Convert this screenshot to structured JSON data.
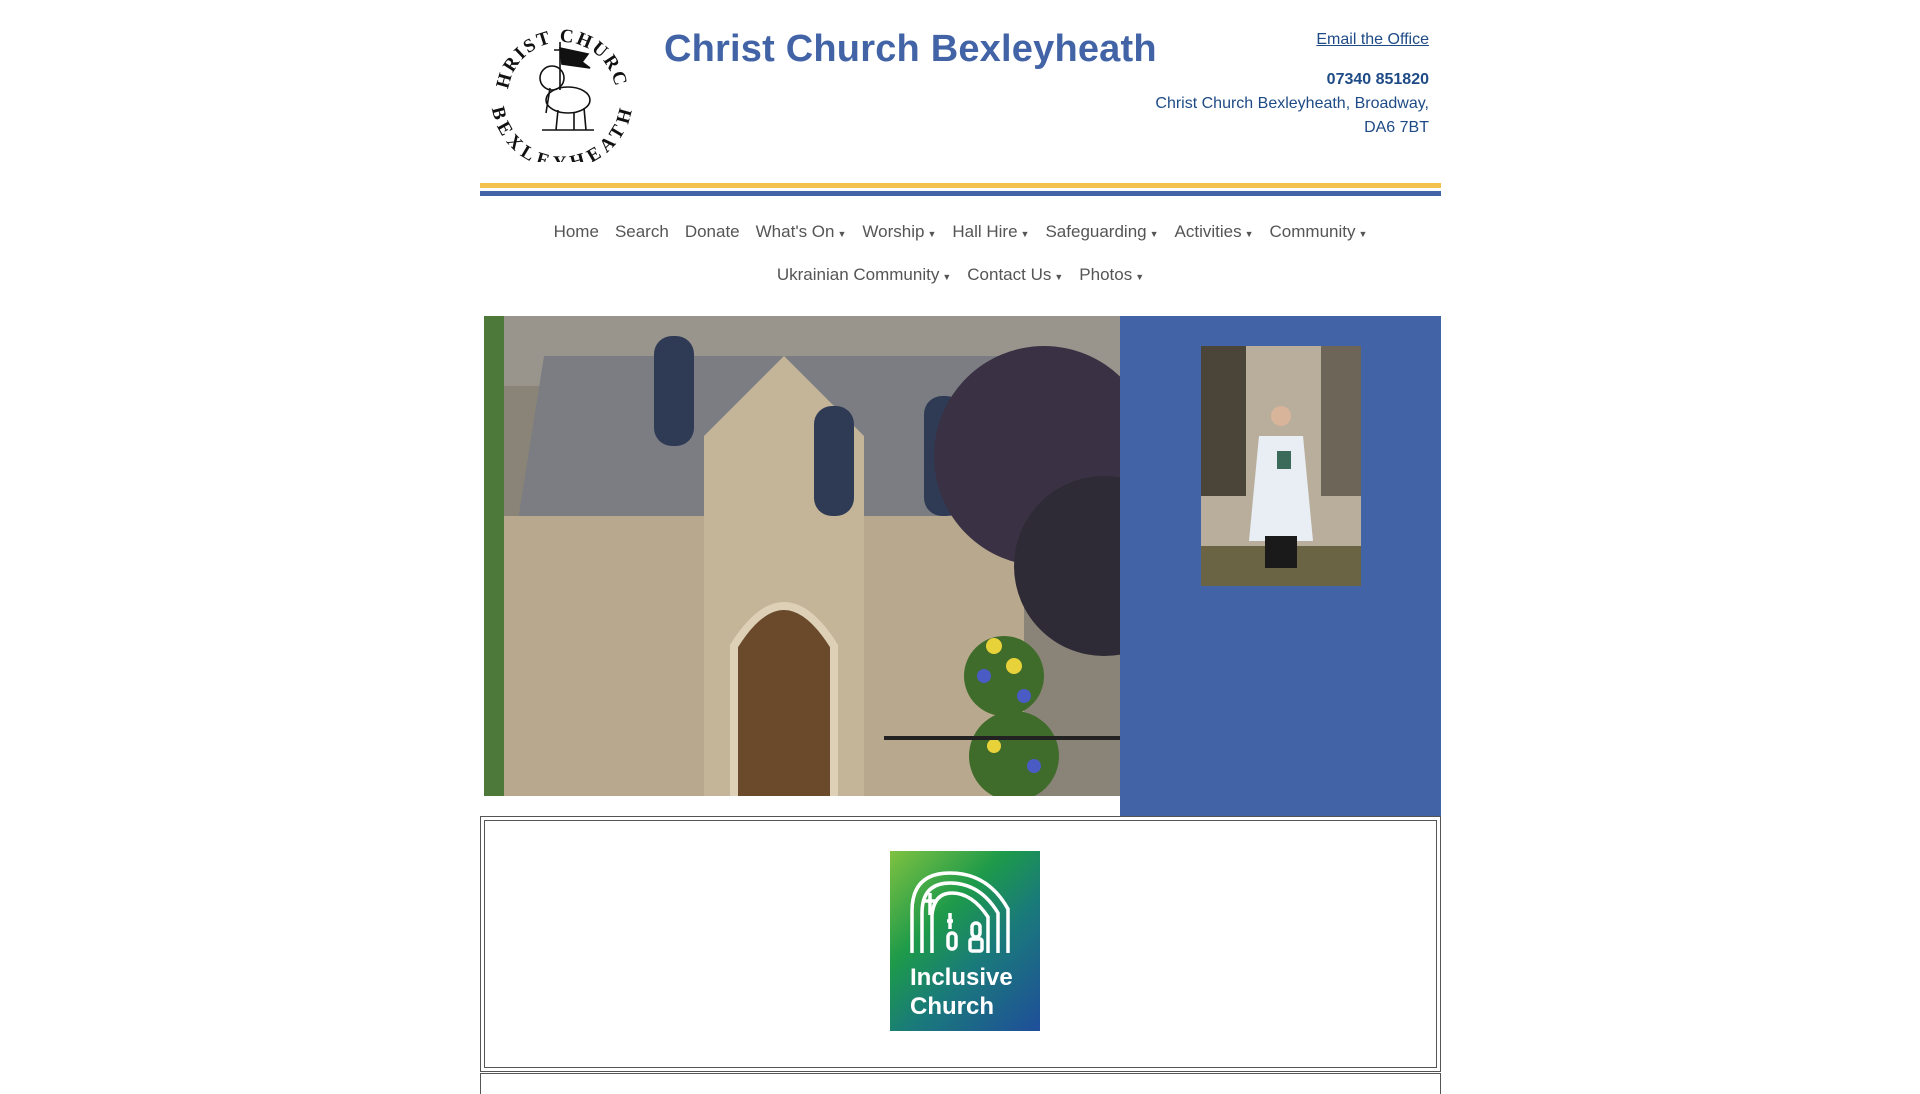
{
  "site": {
    "title": "Christ Church Bexleyheath",
    "logo_top_text": "CHRIST CHURCH",
    "logo_bottom_text": "BEXLEYHEATH"
  },
  "contact": {
    "email_link": "Email the Office",
    "phone": "07340 851820",
    "address_line1": "Christ Church Bexleyheath, Broadway,",
    "address_line2": "DA6 7BT"
  },
  "nav": {
    "row1": [
      {
        "label": "Home",
        "dropdown": false
      },
      {
        "label": "Search",
        "dropdown": false
      },
      {
        "label": "Donate",
        "dropdown": false
      },
      {
        "label": "What's On",
        "dropdown": true
      },
      {
        "label": "Worship",
        "dropdown": true
      },
      {
        "label": "Hall Hire",
        "dropdown": true
      },
      {
        "label": "Safeguarding",
        "dropdown": true
      },
      {
        "label": "Activities",
        "dropdown": true
      },
      {
        "label": "Community",
        "dropdown": true
      }
    ],
    "row2": [
      {
        "label": "Ukrainian Community",
        "dropdown": true
      },
      {
        "label": "Contact Us",
        "dropdown": true
      },
      {
        "label": "Photos",
        "dropdown": true
      }
    ],
    "caret": "▼"
  },
  "badge": {
    "line1": "Inclusive",
    "line2": "Church"
  },
  "colors": {
    "brand_blue": "#4264a6",
    "gold": "#f2c14e",
    "link_blue": "#1e4b86"
  }
}
